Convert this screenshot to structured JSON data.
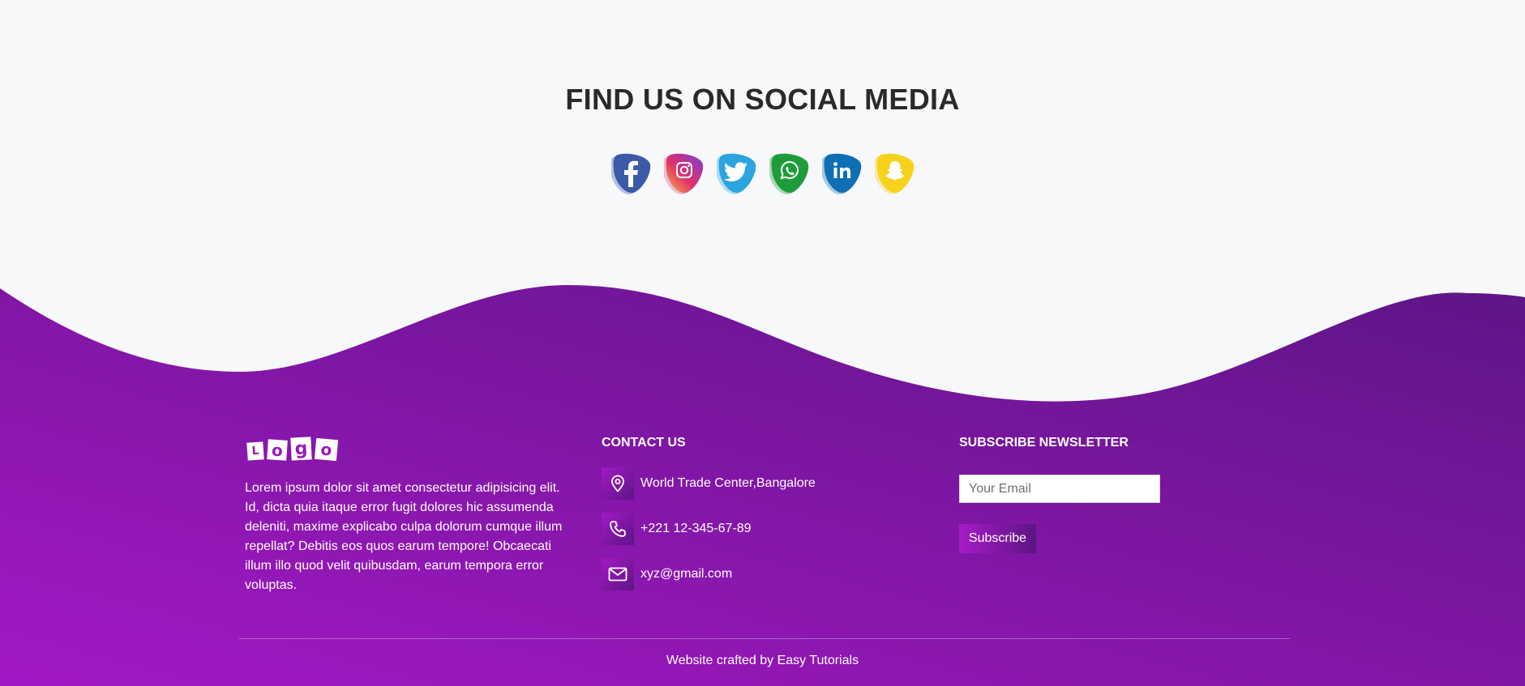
{
  "social": {
    "title": "FIND US ON SOCIAL MEDIA",
    "icons": [
      {
        "name": "facebook-icon",
        "color": "#3b5ba7"
      },
      {
        "name": "instagram-icon",
        "color": "#d6336c"
      },
      {
        "name": "twitter-icon",
        "color": "#2aa5e0"
      },
      {
        "name": "whatsapp-icon",
        "color": "#1e9c3a"
      },
      {
        "name": "linkedin-icon",
        "color": "#0e6fb4"
      },
      {
        "name": "snapchat-icon",
        "color": "#f7d21b"
      }
    ]
  },
  "footer": {
    "gradient": [
      "#a318c5",
      "#5e1586"
    ],
    "logo": {
      "letters": [
        "L",
        "o",
        "g",
        "o"
      ]
    },
    "about": "Lorem ipsum dolor sit amet consectetur adipisicing elit. Id, dicta quia itaque error fugit dolores hic assumenda deleniti, maxime explicabo culpa dolorum cumque illum repellat? Debitis eos quos earum tempore! Obcaecati illum illo quod velit quibusdam, earum tempora error voluptas.",
    "contact": {
      "heading": "CONTACT US",
      "items": [
        {
          "icon": "location-pin-icon",
          "text": "World Trade Center,Bangalore"
        },
        {
          "icon": "phone-icon",
          "text": "+221 12-345-67-89"
        },
        {
          "icon": "mail-icon",
          "text": "xyz@gmail.com"
        }
      ]
    },
    "newsletter": {
      "heading": "SUBSCRIBE NEWSLETTER",
      "placeholder": "Your Email",
      "button": "Subscribe"
    },
    "credit": "Website crafted by Easy Tutorials"
  }
}
